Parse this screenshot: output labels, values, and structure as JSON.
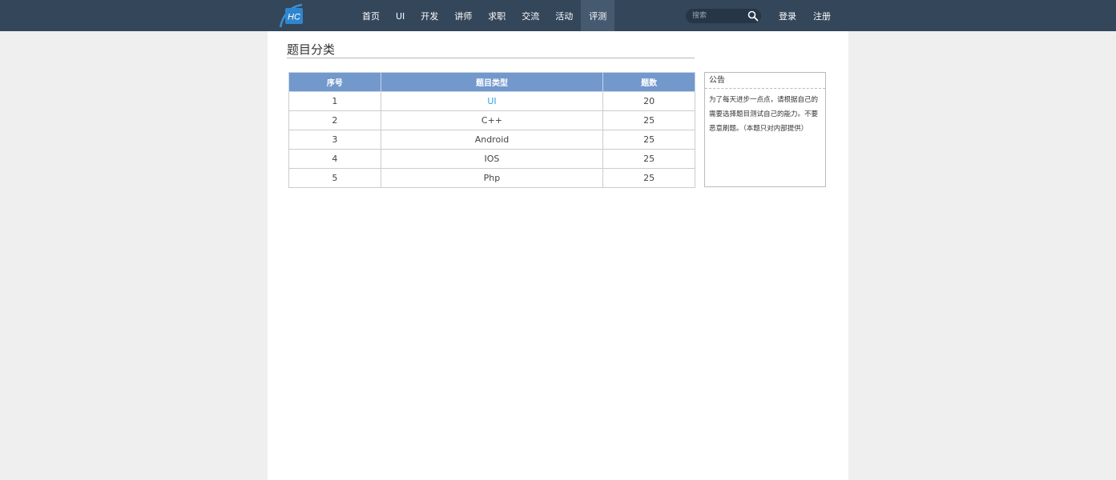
{
  "nav": {
    "items": [
      {
        "label": "首页"
      },
      {
        "label": "UI"
      },
      {
        "label": "开发"
      },
      {
        "label": "讲师"
      },
      {
        "label": "求职"
      },
      {
        "label": "交流"
      },
      {
        "label": "活动"
      },
      {
        "label": "评测"
      }
    ],
    "active": "评测"
  },
  "logo": {
    "text": "HC"
  },
  "search": {
    "placeholder": "搜索"
  },
  "auth": {
    "login": "登录",
    "register": "注册"
  },
  "page": {
    "title": "题目分类"
  },
  "table": {
    "headers": [
      "序号",
      "题目类型",
      "题数"
    ],
    "rows": [
      {
        "index": "1",
        "type": "UI",
        "count": "20"
      },
      {
        "index": "2",
        "type": "C++",
        "count": "25"
      },
      {
        "index": "3",
        "type": "Android",
        "count": "25"
      },
      {
        "index": "4",
        "type": "IOS",
        "count": "25"
      },
      {
        "index": "5",
        "type": "Php",
        "count": "25"
      }
    ]
  },
  "notice": {
    "title": "公告",
    "body": "为了每天进步一点点，请根据自己的需要选择题目测试自己的能力。不要恶意刷题。（本题只对内部提供）"
  },
  "colors": {
    "topbar": "#34465a",
    "table_header": "#7298cc",
    "link": "#2aa0e0",
    "page_bg": "#efefef"
  }
}
